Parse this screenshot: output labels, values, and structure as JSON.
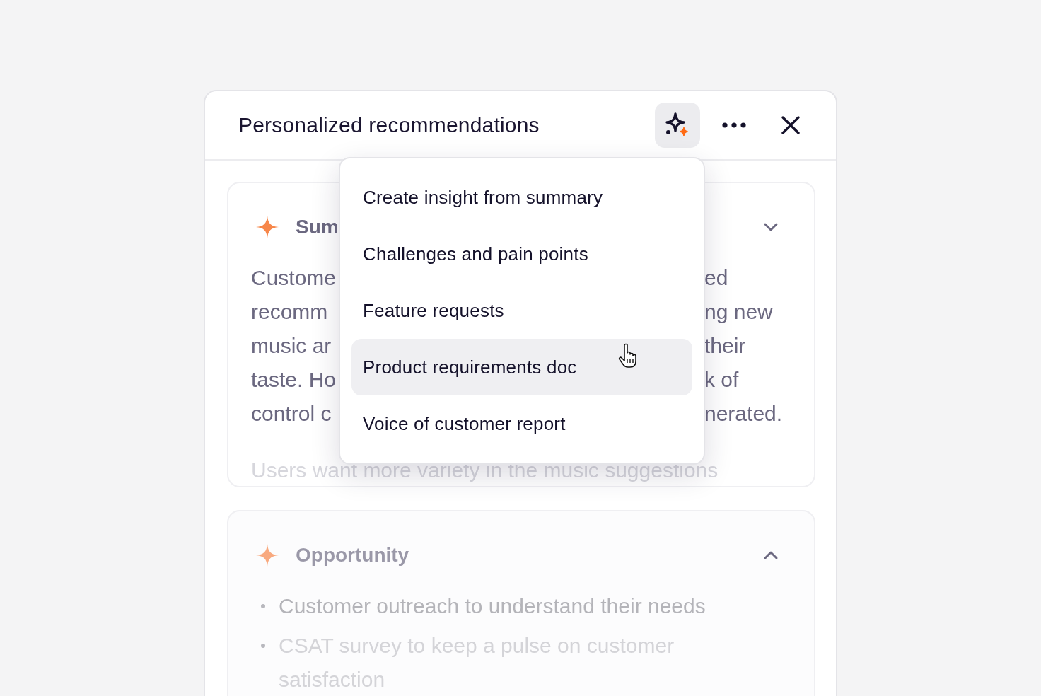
{
  "panel": {
    "title": "Personalized recommendations",
    "ai_button": {
      "active": true
    }
  },
  "cards": [
    {
      "title": "Sum",
      "expanded": false,
      "lines": [
        {
          "left": "Custome",
          "right": "ed"
        },
        {
          "left": "recomm",
          "right": "ng new"
        },
        {
          "left": "music ar",
          "right": "their"
        },
        {
          "left": "taste. Ho",
          "right": "k of"
        },
        {
          "left": "control c",
          "right": "nerated."
        }
      ],
      "trailing": "Users want more variety in the music suggestions"
    },
    {
      "title": "Opportunity",
      "expanded": true,
      "bullets": [
        "Customer outreach to understand their needs",
        "CSAT survey to keep a pulse on customer satisfaction"
      ]
    }
  ],
  "menu": [
    {
      "label": "Create insight from summary",
      "selected": false
    },
    {
      "label": "Challenges and pain points",
      "selected": false
    },
    {
      "label": "Feature requests",
      "selected": false
    },
    {
      "label": "Product requirements doc",
      "selected": true
    },
    {
      "label": "Voice of customer report",
      "selected": false
    }
  ]
}
